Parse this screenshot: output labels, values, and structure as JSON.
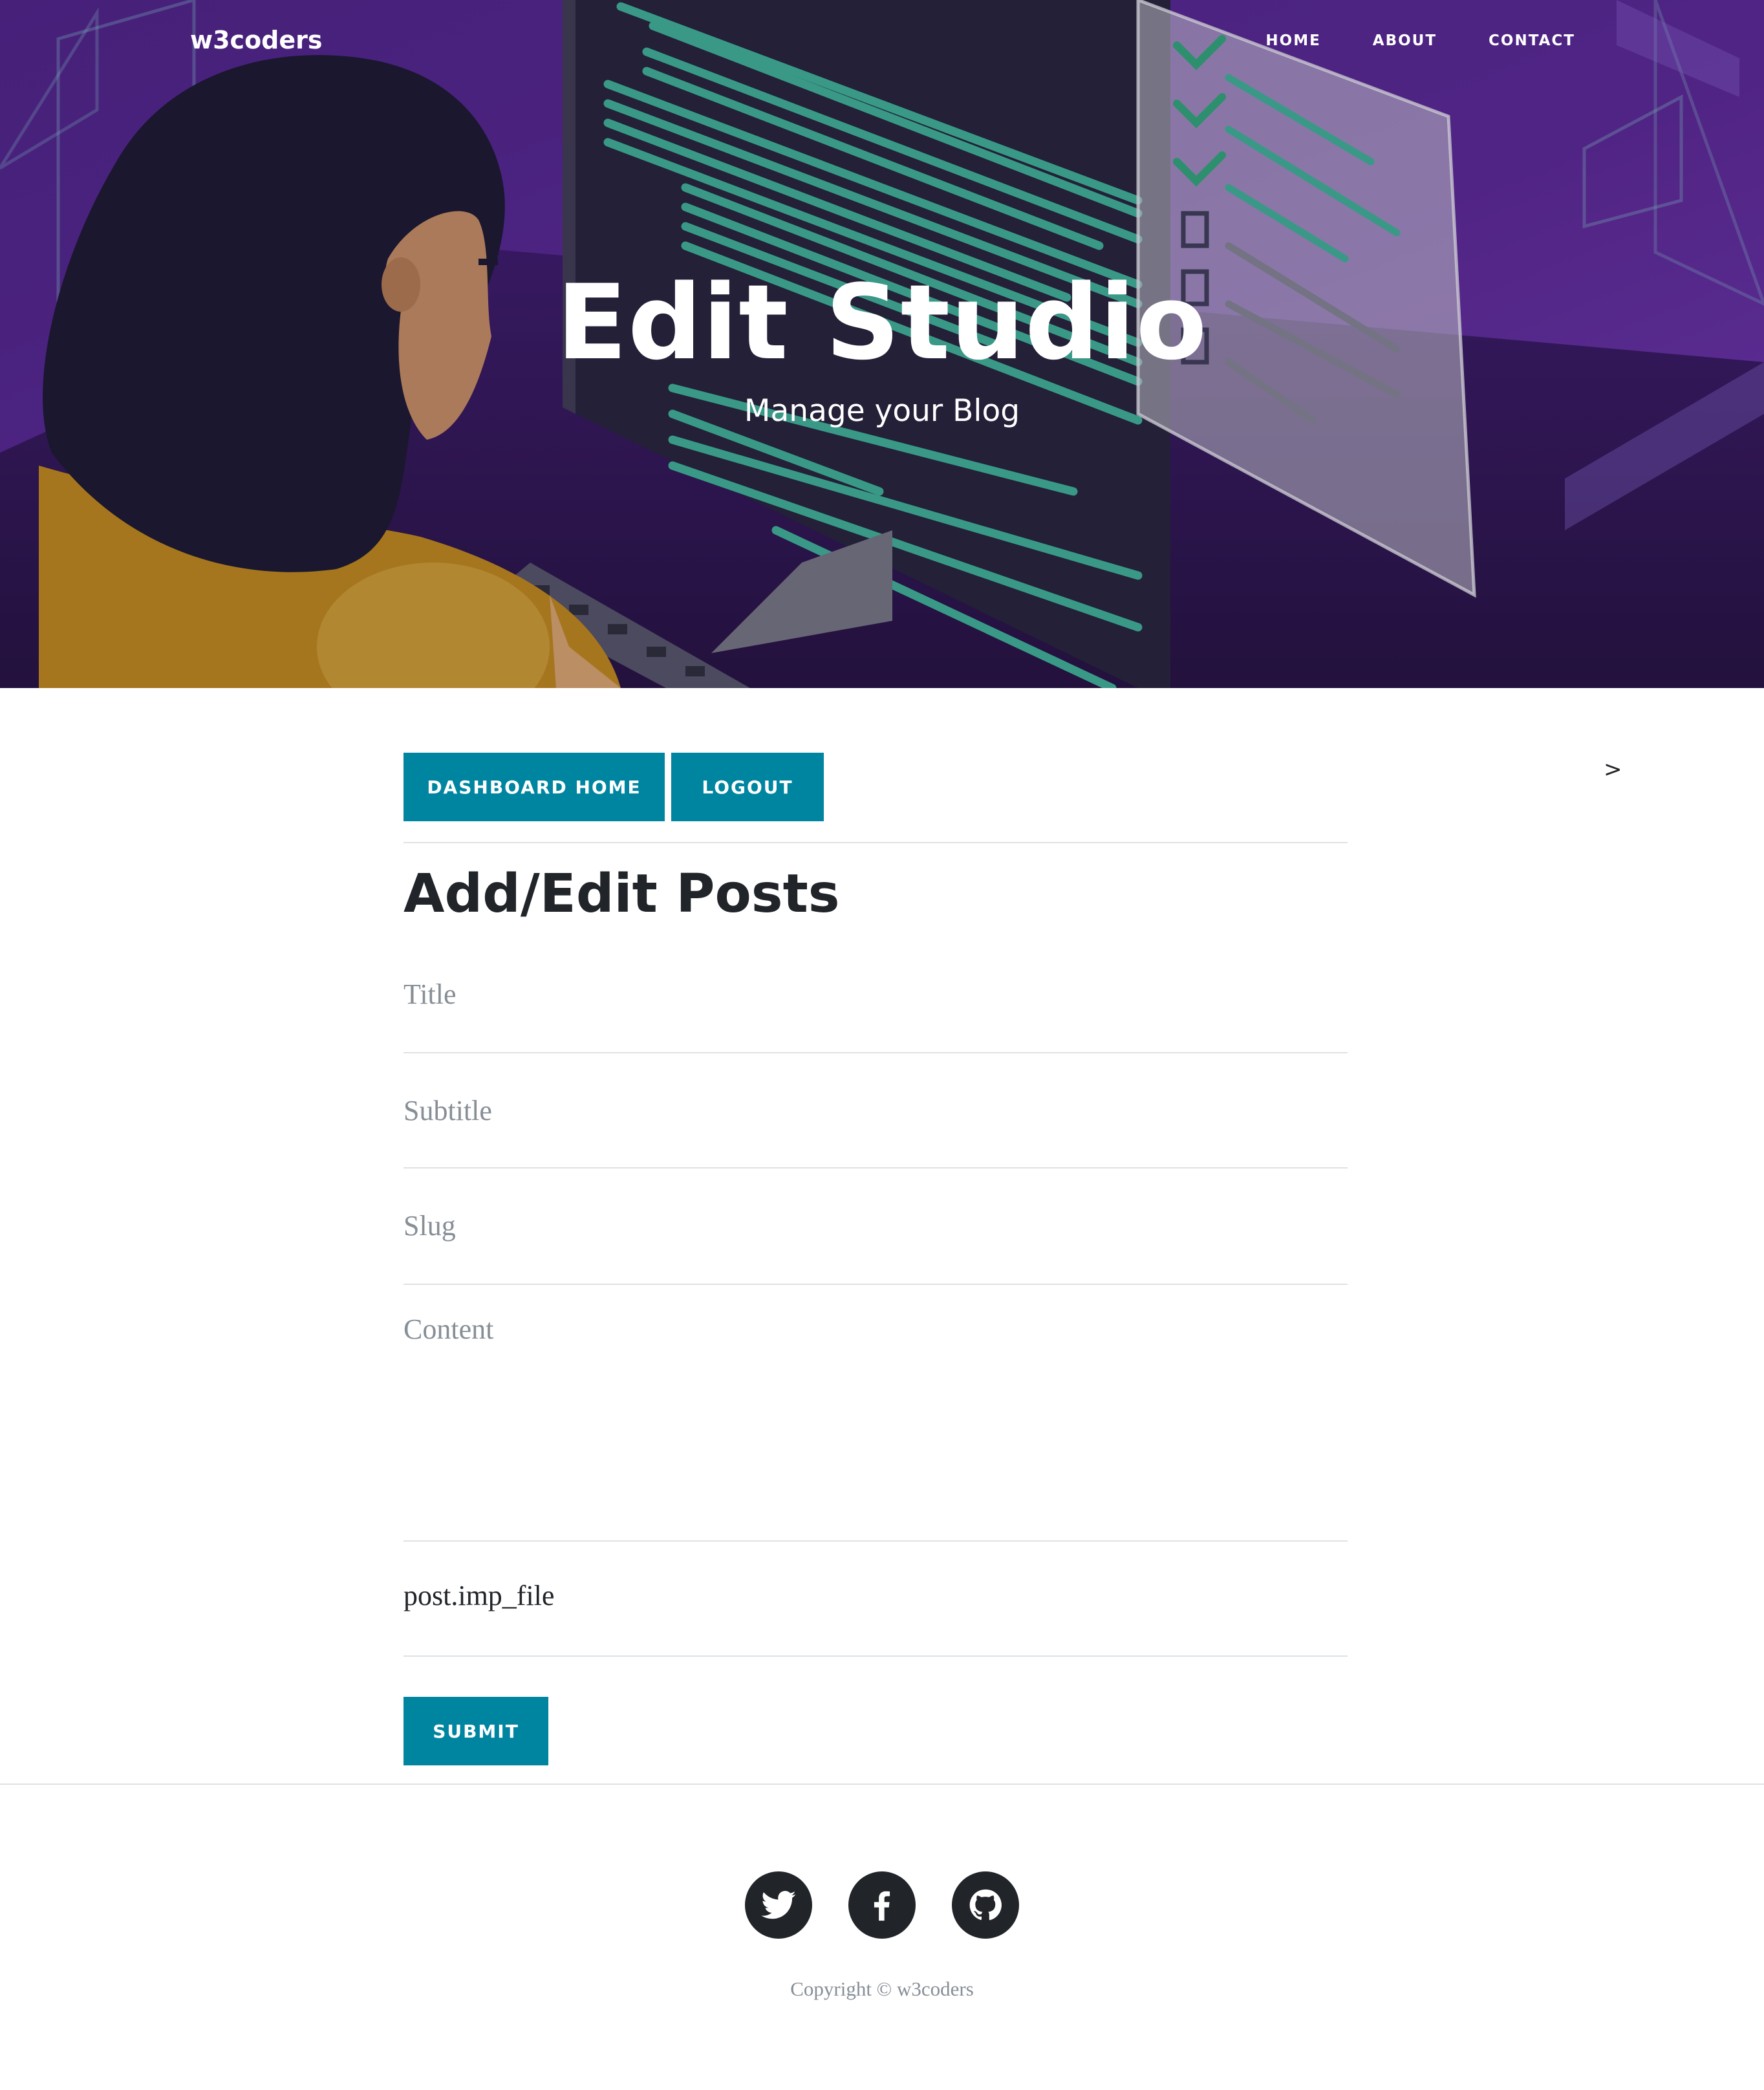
{
  "navbar": {
    "brand": "w3coders",
    "links": [
      "HOME",
      "ABOUT",
      "CONTACT"
    ]
  },
  "hero": {
    "title": "Edit Studio",
    "subtitle": "Manage your Blog"
  },
  "actions": {
    "dashboard_label": "DASHBOARD HOME",
    "logout_label": "LOGOUT",
    "caret": ">"
  },
  "form": {
    "heading": "Add/Edit Posts",
    "title_placeholder": "Title",
    "subtitle_placeholder": "Subtitle",
    "slug_placeholder": "Slug",
    "content_placeholder": "Content",
    "file_label": "post.imp_file",
    "submit_label": "SUBMIT"
  },
  "footer": {
    "socials": [
      "twitter-icon",
      "facebook-icon",
      "github-icon"
    ],
    "copyright": "Copyright © w3coders"
  },
  "colors": {
    "accent": "#0085a1",
    "hero_purple": "#5b2d91",
    "text_dark": "#212529",
    "muted": "#868e96"
  }
}
